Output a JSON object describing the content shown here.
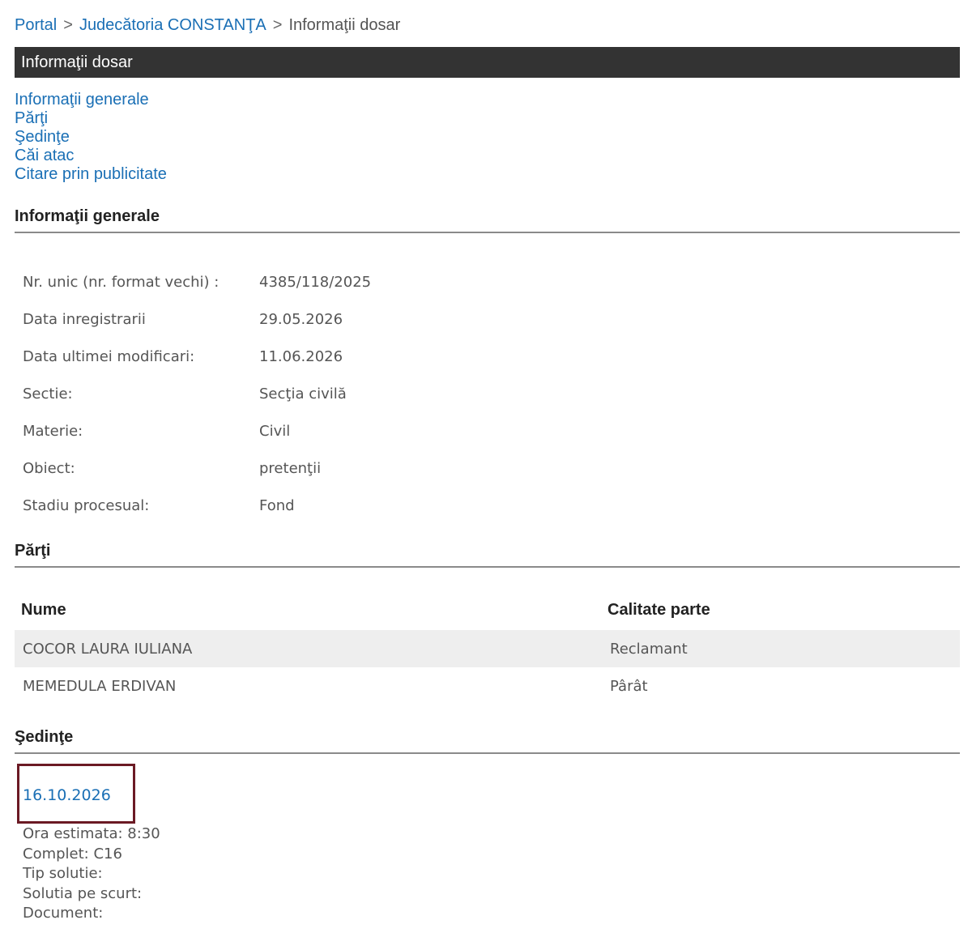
{
  "breadcrumb": {
    "portal": "Portal",
    "separator": ">",
    "court": "Judecătoria CONSTANŢA",
    "current": "Informaţii dosar"
  },
  "title_bar": "Informaţii dosar",
  "toc": [
    "Informaţii generale",
    "Părţi",
    "Şedinţe",
    "Căi atac",
    "Citare prin publicitate"
  ],
  "general_info": {
    "heading": "Informaţii generale",
    "rows": [
      {
        "label": "Nr. unic (nr. format vechi) :",
        "value": "4385/118/2025"
      },
      {
        "label": "Data inregistrarii",
        "value": "29.05.2026"
      },
      {
        "label": "Data ultimei modificari:",
        "value": "11.06.2026"
      },
      {
        "label": "Sectie:",
        "value": "Secţia civilă"
      },
      {
        "label": "Materie:",
        "value": "Civil"
      },
      {
        "label": "Obiect:",
        "value": "pretenţii"
      },
      {
        "label": "Stadiu procesual:",
        "value": "Fond"
      }
    ]
  },
  "parties": {
    "heading": "Părţi",
    "columns": [
      "Nume",
      "Calitate parte"
    ],
    "rows": [
      {
        "name": "COCOR LAURA IULIANA",
        "role": "Reclamant"
      },
      {
        "name": "MEMEDULA ERDIVAN",
        "role": "Pârât"
      }
    ]
  },
  "hearings": {
    "heading": "Şedinţe",
    "date": "16.10.2026",
    "details": [
      "Ora estimata: 8:30",
      "Complet: C16",
      "Tip solutie:",
      "Solutia pe scurt:",
      "Document:"
    ]
  },
  "colors": {
    "link": "#1a6fb5",
    "title_bar_bg": "#333333",
    "highlight_border": "#6b1a24",
    "row_shade": "#eeeeee"
  }
}
